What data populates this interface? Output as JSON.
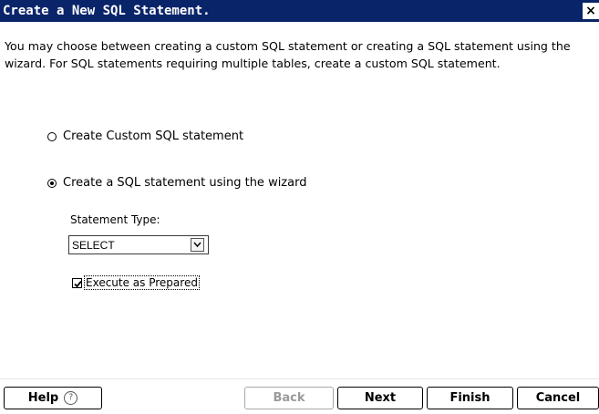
{
  "window": {
    "title": "Create a New SQL Statement.",
    "close_label": "×"
  },
  "description": "You may choose between creating a custom SQL statement or creating a SQL statement using the wizard. For SQL statements requiring multiple tables, create a custom SQL statement.",
  "options": {
    "custom_label": "Create Custom SQL statement",
    "custom_selected": false,
    "wizard_label": "Create a SQL statement using the wizard",
    "wizard_selected": true
  },
  "statement_type": {
    "label": "Statement Type:",
    "value": "SELECT"
  },
  "execute_prepared": {
    "label": "Execute as Prepared",
    "checked": true
  },
  "buttons": {
    "help": "Help",
    "help_icon": "?",
    "back": "Back",
    "next": "Next",
    "finish": "Finish",
    "cancel": "Cancel"
  }
}
